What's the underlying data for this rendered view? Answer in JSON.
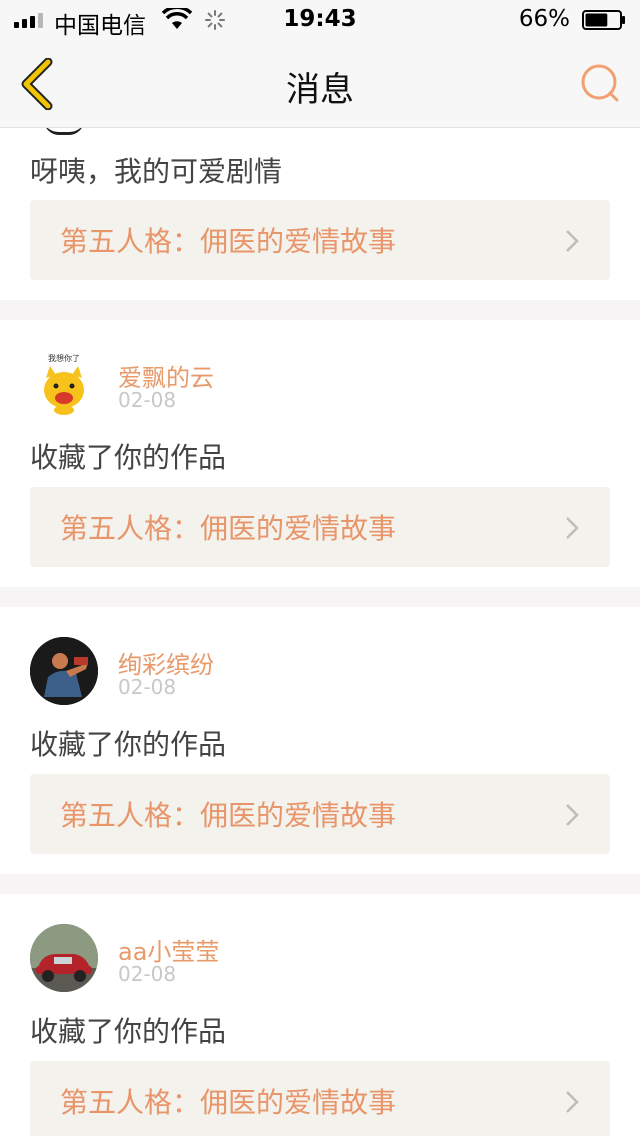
{
  "status_bar": {
    "carrier": "中国电信",
    "time": "19:43",
    "battery": "66%",
    "battery_level": 0.66
  },
  "nav": {
    "title": "消息",
    "back_icon": "chevron-left-icon",
    "search_icon": "search-icon"
  },
  "colors": {
    "accent": "#e8956a",
    "back_icon": "#f0c400",
    "search_icon": "#f2a070",
    "box_bg": "#f3f2ed"
  },
  "messages": [
    {
      "text": "呀咦，我的可爱剧情",
      "work_title": "第五人格：佣医的爱情故事"
    },
    {
      "user": "爱飘的云",
      "date": "02-08",
      "avatar_caption": "我想你了",
      "text": "收藏了你的作品",
      "work_title": "第五人格：佣医的爱情故事"
    },
    {
      "user": "绚彩缤纷",
      "date": "02-08",
      "text": "收藏了你的作品",
      "work_title": "第五人格：佣医的爱情故事"
    },
    {
      "user": "aa小莹莹",
      "date": "02-08",
      "text": "收藏了你的作品",
      "work_title": "第五人格：佣医的爱情故事"
    }
  ]
}
